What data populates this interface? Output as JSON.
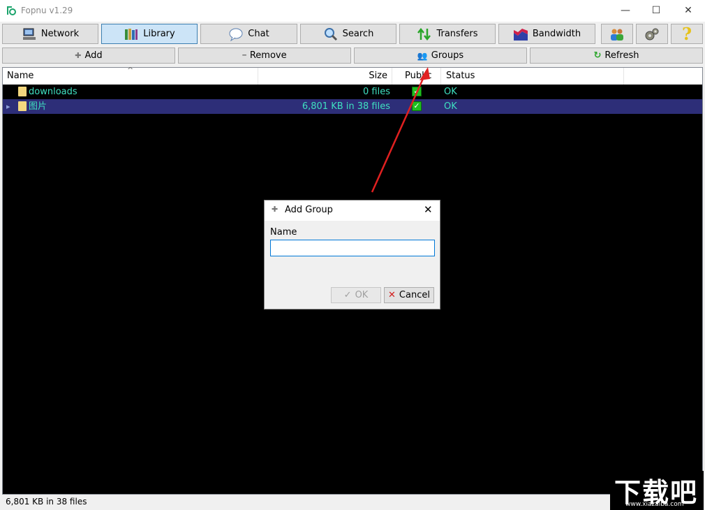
{
  "window": {
    "title": "Fopnu v1.29",
    "minimize_glyph": "—",
    "maximize_glyph": "☐",
    "close_glyph": "✕"
  },
  "toolbar": {
    "tabs": [
      {
        "label": "Network",
        "icon": "network-computer-icon"
      },
      {
        "label": "Library",
        "icon": "books-icon",
        "active": true
      },
      {
        "label": "Chat",
        "icon": "chat-bubble-icon"
      },
      {
        "label": "Search",
        "icon": "magnifier-icon"
      },
      {
        "label": "Transfers",
        "icon": "transfer-arrows-icon"
      },
      {
        "label": "Bandwidth",
        "icon": "bandwidth-chart-icon"
      }
    ],
    "icon_buttons": [
      "users-icon",
      "gears-icon",
      "help-icon"
    ],
    "help_glyph": "?"
  },
  "actions": {
    "add_label": "Add",
    "add_glyph": "✚",
    "remove_label": "Remove",
    "remove_glyph": "━",
    "groups_label": "Groups",
    "groups_glyph": "👥",
    "refresh_label": "Refresh",
    "refresh_glyph": "↻"
  },
  "columns": {
    "name": "Name",
    "size": "Size",
    "public": "Public",
    "status": "Status",
    "sort_glyph": "^"
  },
  "rows": [
    {
      "name": "downloads",
      "size": "0 files",
      "public": true,
      "status": "OK"
    },
    {
      "name": "图片",
      "size": "6,801 KB in 38 files",
      "public": true,
      "status": "OK",
      "expand_glyph": "▸"
    }
  ],
  "check_glyph": "✓",
  "status_bar": {
    "text": "6,801 KB in 38 files"
  },
  "dialog": {
    "title": "Add Group",
    "title_glyph": "✚",
    "close_glyph": "✕",
    "name_label": "Name",
    "name_value": "",
    "ok_label": "OK",
    "ok_glyph": "✓",
    "cancel_label": "Cancel",
    "cancel_glyph": "✕"
  },
  "watermark": {
    "text": "下载吧",
    "url_text": "www.xiazaiba.com"
  },
  "colors": {
    "accent_active": "#cce4f7",
    "row_text": "#3fe0c0",
    "row_selected": "#2d2e78",
    "annotation_arrow": "#e02020"
  }
}
